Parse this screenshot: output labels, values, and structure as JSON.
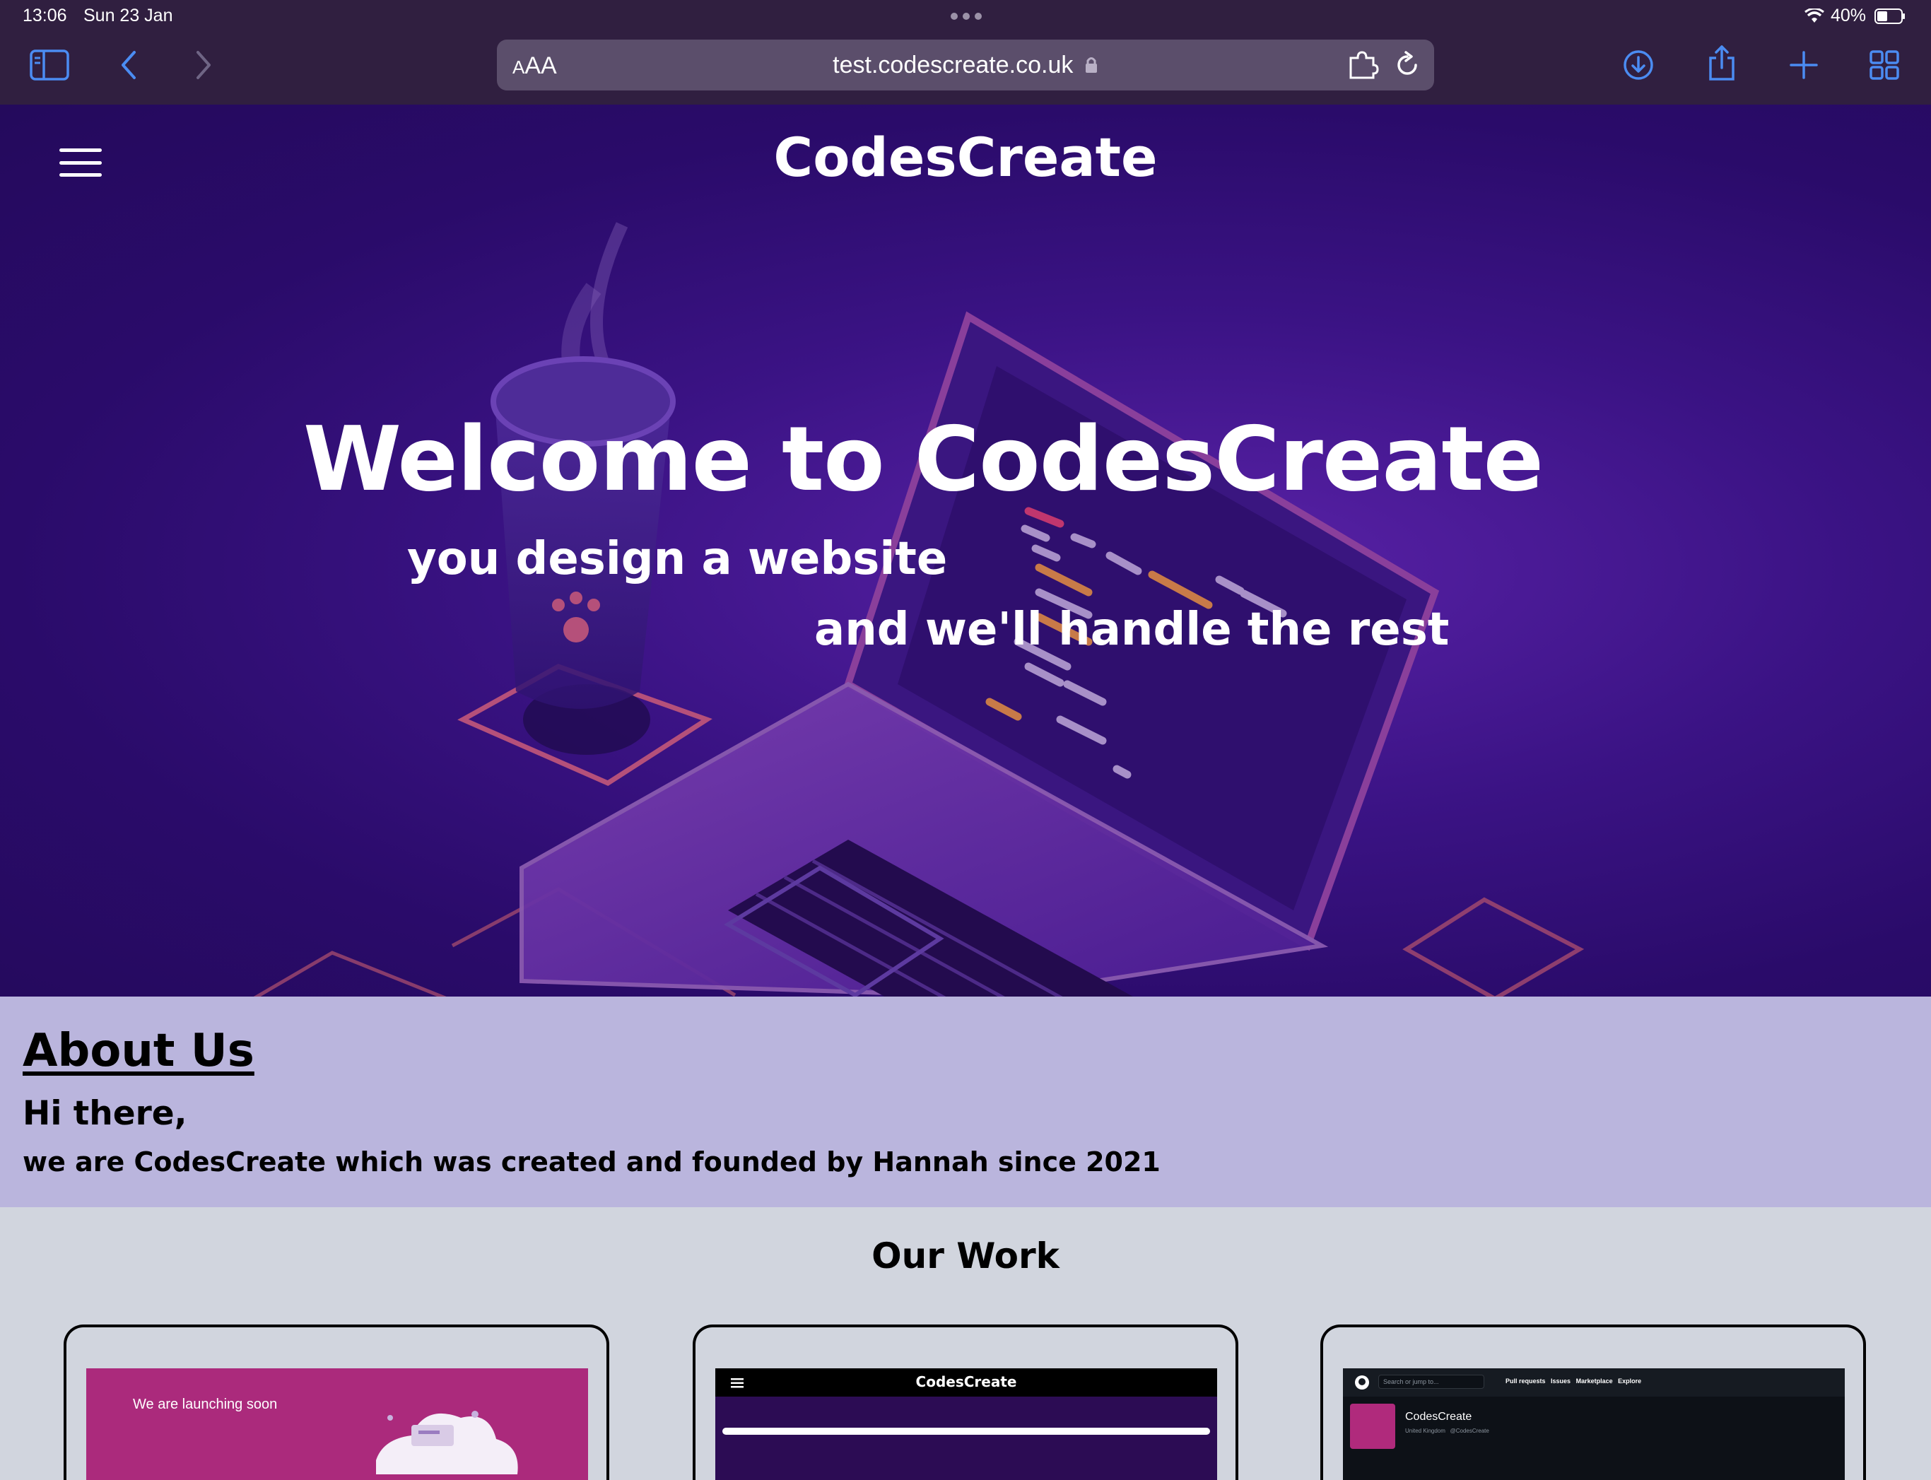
{
  "status_bar": {
    "time": "13:06",
    "date": "Sun 23 Jan",
    "battery": "40%"
  },
  "browser": {
    "url": "test.codescreate.co.uk",
    "text_size_label": "AA"
  },
  "site": {
    "title": "CodesCreate",
    "hero": {
      "heading": "Welcome to CodesCreate",
      "line1": "you design a website",
      "line2": "and we'll handle the rest"
    },
    "about": {
      "title": "About Us",
      "greeting": "Hi there,",
      "text": "we are CodesCreate which was created and founded by Hannah since 2021"
    },
    "work": {
      "title": "Our Work",
      "cards": [
        {
          "caption": "We are launching soon"
        },
        {
          "caption": "CodesCreate"
        },
        {
          "caption": "CodesCreate",
          "search_placeholder": "Search or jump to...",
          "nav": [
            "Pull requests",
            "Issues",
            "Marketplace",
            "Explore"
          ],
          "location": "United Kingdom",
          "handle": "@CodesCreate"
        }
      ]
    }
  },
  "colors": {
    "chrome": "#301f40",
    "accent": "#4b8cf2",
    "hero": "#2a0b6a",
    "about_bg": "#bab5dd",
    "work_bg": "#d1d5de",
    "card1_bg": "#ab2a7c"
  }
}
